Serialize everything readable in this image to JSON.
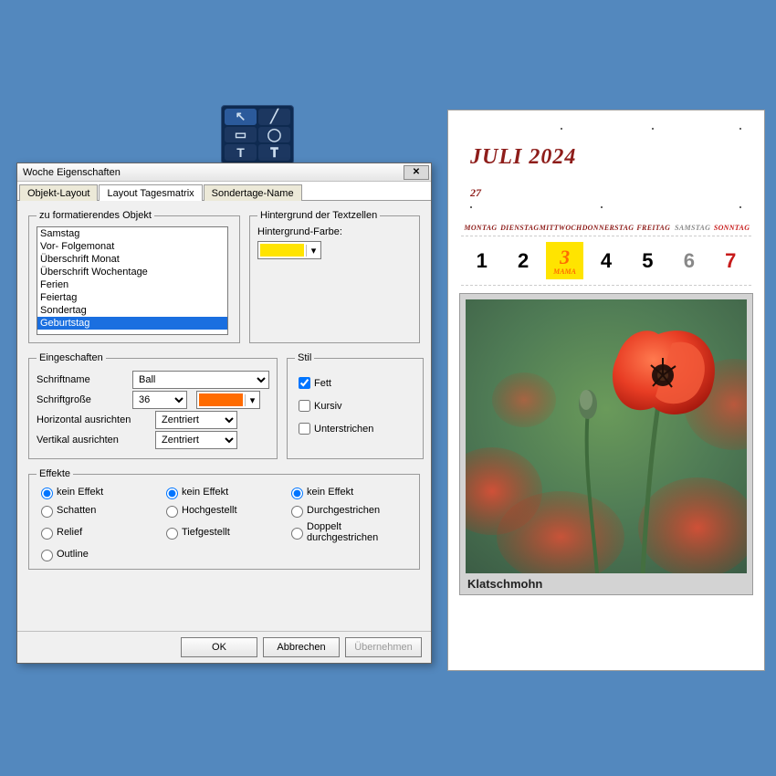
{
  "toolbar": {
    "icons": [
      "cursor",
      "line",
      "round-rect",
      "circle",
      "text",
      "text-frame"
    ]
  },
  "dialog": {
    "title": "Woche Eigenschaften",
    "close": "✕",
    "tabs": [
      {
        "label": "Objekt-Layout",
        "active": false
      },
      {
        "label": "Layout Tagesmatrix",
        "active": true
      },
      {
        "label": "Sondertage-Name",
        "active": false
      }
    ],
    "groupObject": {
      "legend": "zu formatierendes Objekt",
      "items": [
        "Samstag",
        "Vor- Folgemonat",
        "Überschrift Monat",
        "Überschrift Wochentage",
        "Ferien",
        "Feiertag",
        "Sondertag",
        "Geburtstag"
      ],
      "selected": "Geburtstag"
    },
    "groupBg": {
      "legend": "Hintergrund der Textzellen",
      "label": "Hintergrund-Farbe:",
      "color": "#ffe400"
    },
    "groupProps": {
      "legend": "Eingeschaften",
      "font_label": "Schriftname",
      "font_value": "Ball",
      "size_label": "Schriftgroße",
      "size_value": "36",
      "color": "#ff6b00",
      "halign_label": "Horizontal ausrichten",
      "halign_value": "Zentriert",
      "valign_label": "Vertikal ausrichten",
      "valign_value": "Zentriert"
    },
    "groupStyle": {
      "legend": "Stil",
      "bold": "Fett",
      "italic": "Kursiv",
      "under": "Unterstrichen"
    },
    "groupEffects": {
      "legend": "Effekte",
      "col1": [
        "kein Effekt",
        "Schatten",
        "Relief",
        "Outline"
      ],
      "col2": [
        "kein Effekt",
        "Hochgestellt",
        "Tiefgestellt"
      ],
      "col3": [
        "kein Effekt",
        "Durchgestrichen",
        "Doppelt durchgestrichen"
      ]
    },
    "buttons": {
      "ok": "OK",
      "cancel": "Abbrechen",
      "apply": "Übernehmen"
    }
  },
  "calendar": {
    "title": "JULI 2024",
    "week": "27",
    "weekdays": [
      "MONTAG",
      "DIENSTAG",
      "MITTWOCH",
      "DONNERSTAG",
      "FREITAG",
      "SAMSTAG",
      "SONNTAG"
    ],
    "days": [
      "1",
      "2",
      "3",
      "4",
      "5",
      "6",
      "7"
    ],
    "day3_sub": "MAMA",
    "caption": "Klatschmohn"
  }
}
